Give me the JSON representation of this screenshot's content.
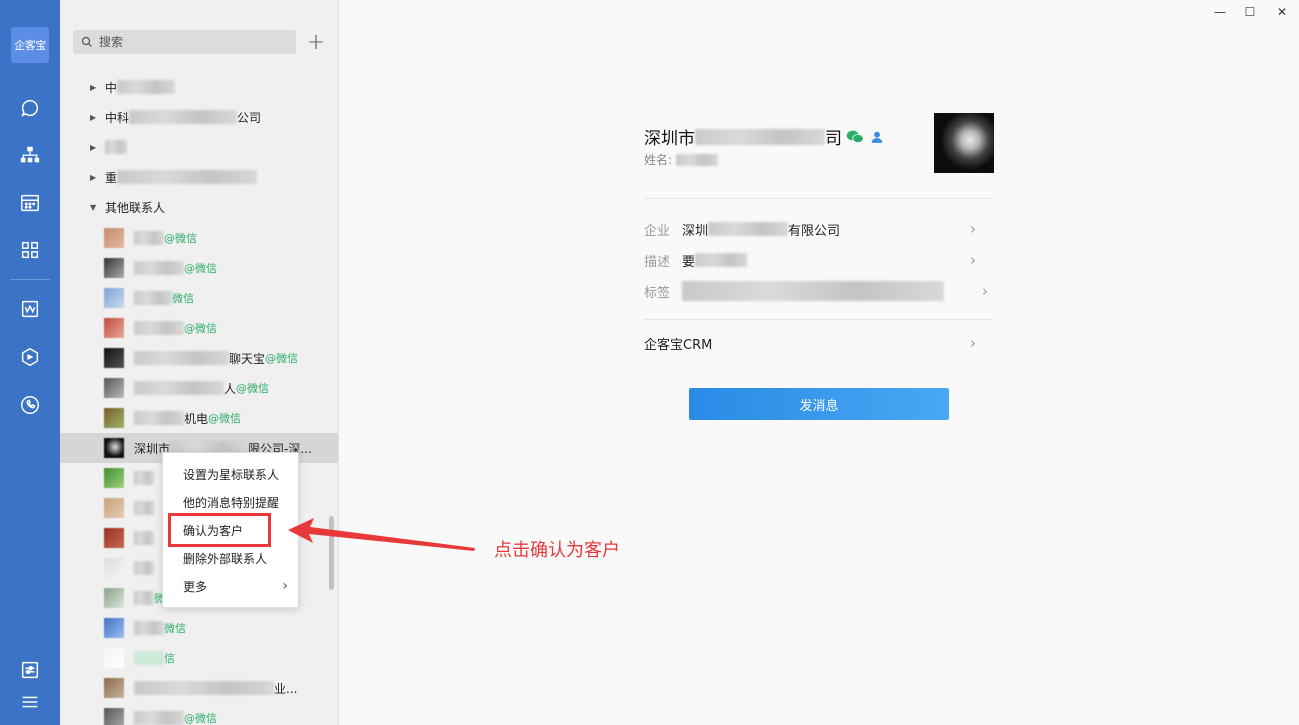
{
  "app": {
    "logo_text": "企客宝"
  },
  "search": {
    "placeholder": "搜索"
  },
  "groups": [
    {
      "prefix": "中",
      "suffix": ""
    },
    {
      "prefix": "中科",
      "suffix": "公司"
    },
    {
      "prefix": "",
      "suffix": ""
    },
    {
      "prefix": "重",
      "suffix": ""
    },
    {
      "prefix": "其他联系人",
      "suffix": ""
    }
  ],
  "contacts": [
    {
      "name_prefix": "",
      "name_suffix": "",
      "tag": "@微信"
    },
    {
      "name_prefix": "",
      "name_suffix": "",
      "tag": "@微信"
    },
    {
      "name_prefix": "",
      "name_suffix": "",
      "tag": "微信"
    },
    {
      "name_prefix": "",
      "name_suffix": "",
      "tag": "@微信"
    },
    {
      "name_prefix": "",
      "name_suffix": "聊天宝",
      "tag": "@微信"
    },
    {
      "name_prefix": "",
      "name_suffix": "人",
      "tag": "@微信"
    },
    {
      "name_prefix": "",
      "name_suffix": "机电",
      "tag": "@微信"
    },
    {
      "name_prefix": "深圳市",
      "name_suffix": "限公司-深...",
      "tag": ""
    }
  ],
  "contacts_below": [
    {
      "tag": ""
    },
    {
      "tag": ""
    },
    {
      "tag": ""
    },
    {
      "tag": ""
    },
    {
      "tag": "微信"
    },
    {
      "tag": "微信"
    },
    {
      "tag": "信"
    },
    {
      "tag": "业..."
    },
    {
      "tag": "@微信"
    }
  ],
  "context_menu": {
    "items": [
      "设置为星标联系人",
      "他的消息特别提醒",
      "确认为客户",
      "删除外部联系人",
      "更多"
    ],
    "more_chevron": "›"
  },
  "annotation": {
    "text": "点击确认为客户"
  },
  "window": {
    "minimize": "—",
    "maximize": "☐",
    "close": "✕"
  },
  "detail": {
    "name_prefix": "深圳市",
    "name_suffix": "司",
    "subtitle_label": "姓名:",
    "rows": [
      {
        "key": "企业",
        "value_prefix": "深圳",
        "value_suffix": "有限公司"
      },
      {
        "key": "描述",
        "value_prefix": "要",
        "value_suffix": ""
      },
      {
        "key": "标签",
        "value_prefix": "",
        "value_suffix": ""
      }
    ],
    "crm_label": "企客宝CRM",
    "send_button": "发消息"
  },
  "colors": {
    "rail": "#3b73c7",
    "accent": "#2a8ae6",
    "annotation": "#e8393a",
    "wechat": "#2aae67"
  }
}
